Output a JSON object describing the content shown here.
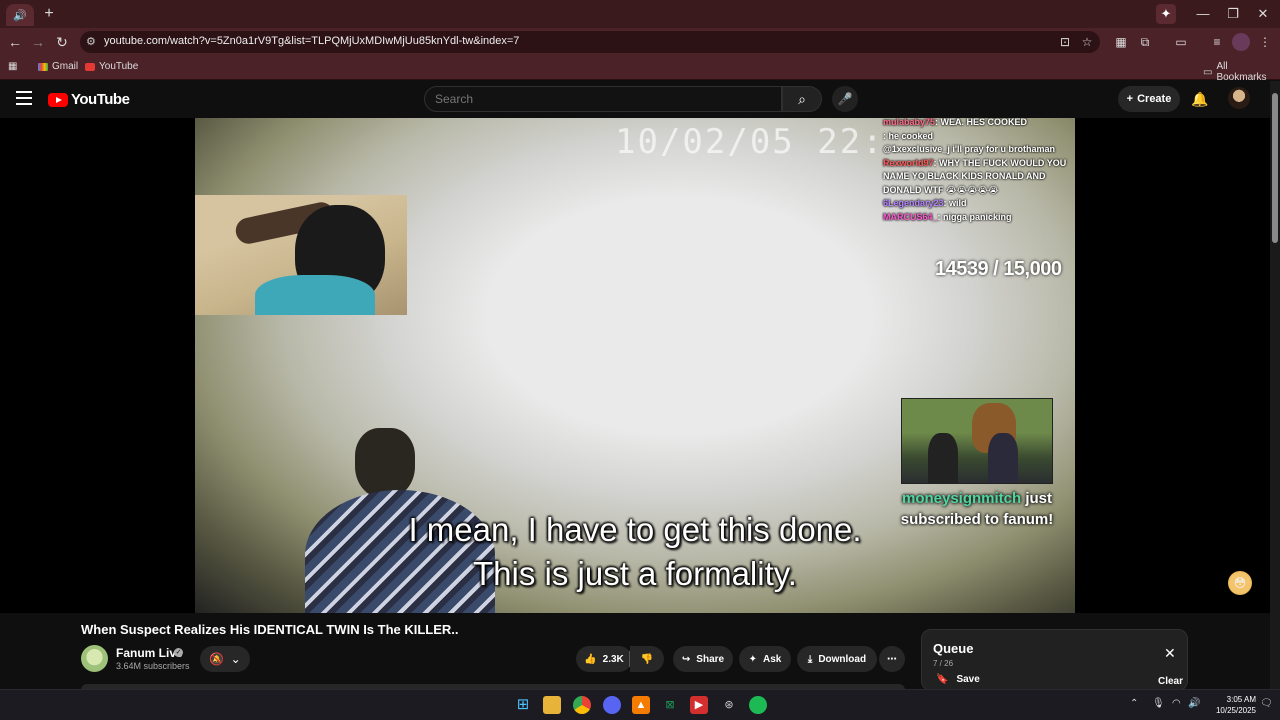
{
  "browser": {
    "url": "youtube.com/watch?v=5Zn0a1rV9Tg&list=TLPQMjUxMDIwMjUu85knYdl-tw&index=7",
    "bookmarks": [
      {
        "label": "Gmail"
      },
      {
        "label": "YouTube"
      }
    ],
    "all_bookmarks": "All Bookmarks"
  },
  "header": {
    "logo_text": "YouTube",
    "search_placeholder": "Search",
    "create_label": "Create"
  },
  "video": {
    "timestamp_overlay": "10/02/05 22:",
    "subtitle_line1": "I mean, I have to get this done.",
    "subtitle_line2": "This is just a formality.",
    "sub_goal": "14539 / 15,000",
    "chat": [
      {
        "user": "mulababy75",
        "message": "WEA. HES COOKED",
        "color": "pink"
      },
      {
        "user": "",
        "message": "he cooked",
        "color": "purple"
      },
      {
        "user": "",
        "message": "@1xexclusive_j i'll pray for u brothaman",
        "color": "blue"
      },
      {
        "user": "Rexworld97",
        "message": "WHY THE FUCK WOULD YOU NAME YO BLACK KIDS RONALD AND DONALD WTF 😭😭😭😭😭",
        "color": "red"
      },
      {
        "user": "6Legendary23",
        "message": "wild",
        "color": "purple"
      },
      {
        "user": "MARCUS64_",
        "message": "nigga panicking",
        "color": "magenta"
      }
    ],
    "alert_name": "moneysignmitch",
    "alert_text_1": "just",
    "alert_text_2": "subscribed to fanum!"
  },
  "meta": {
    "title": "When Suspect Realizes His IDENTICAL TWIN Is The KILLER..",
    "channel": "Fanum Live",
    "subscribers": "3.64M subscribers",
    "likes": "2.3K",
    "share": "Share",
    "ask": "Ask",
    "download": "Download"
  },
  "queue": {
    "title": "Queue",
    "count": "7 / 26",
    "save": "Save",
    "clear": "Clear"
  },
  "taskbar": {
    "time": "3:05 AM",
    "date": "10/25/2025"
  },
  "colors": {
    "browser_frame": "#3b1a1e",
    "yt_red": "#ff0000",
    "alert_name": "#4fd6a0"
  }
}
